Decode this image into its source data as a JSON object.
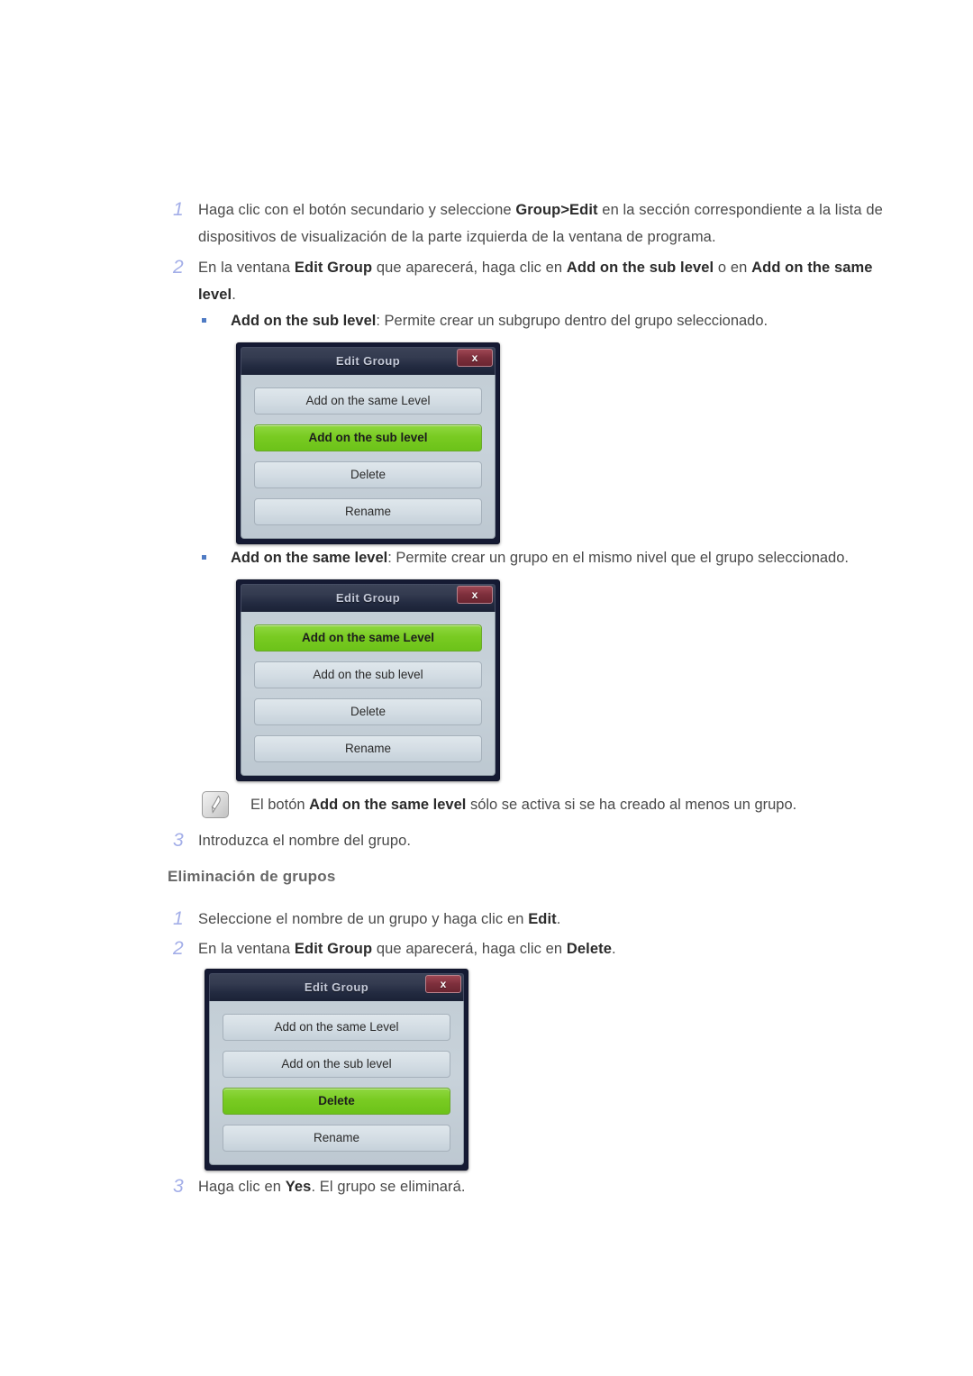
{
  "steps_create": [
    {
      "num": "1",
      "segments": [
        {
          "t": "Haga clic con el botón secundario y seleccione ",
          "b": false
        },
        {
          "t": "Group>Edit",
          "b": true
        },
        {
          "t": " en la sección correspondiente a la lista de dispositivos de visualización de la parte izquierda de la ventana de programa.",
          "b": false
        }
      ]
    },
    {
      "num": "2",
      "segments": [
        {
          "t": "En la ventana ",
          "b": false
        },
        {
          "t": "Edit Group",
          "b": true
        },
        {
          "t": " que aparecerá, haga clic en ",
          "b": false
        },
        {
          "t": "Add on the sub level",
          "b": true
        },
        {
          "t": " o en ",
          "b": false
        },
        {
          "t": "Add on the same level",
          "b": true
        },
        {
          "t": ".",
          "b": false
        }
      ]
    },
    {
      "num": "3",
      "segments": [
        {
          "t": "Introduzca el nombre del grupo.",
          "b": false
        }
      ]
    }
  ],
  "bullet_sub": {
    "marker": "square-bullet",
    "segments": [
      {
        "t": "Add on the sub level",
        "b": true
      },
      {
        "t": ": Permite crear un subgrupo dentro del grupo seleccionado.",
        "b": false
      }
    ]
  },
  "bullet_same": {
    "marker": "square-bullet",
    "segments": [
      {
        "t": "Add on the same level",
        "b": true
      },
      {
        "t": ": Permite crear un grupo en el mismo nivel que el grupo seleccionado.",
        "b": false
      }
    ]
  },
  "note": {
    "icon": "note-pencil-icon",
    "segments": [
      {
        "t": "El botón ",
        "b": false
      },
      {
        "t": "Add on the same level",
        "b": true
      },
      {
        "t": " sólo se activa si se ha creado al menos un grupo.",
        "b": false
      }
    ]
  },
  "section_heading": "Eliminación de grupos",
  "steps_delete": [
    {
      "num": "1",
      "segments": [
        {
          "t": "Seleccione el nombre de un grupo y haga clic en ",
          "b": false
        },
        {
          "t": "Edit",
          "b": true
        },
        {
          "t": ".",
          "b": false
        }
      ]
    },
    {
      "num": "2",
      "segments": [
        {
          "t": "En la ventana ",
          "b": false
        },
        {
          "t": "Edit Group",
          "b": true
        },
        {
          "t": " que aparecerá, haga clic en ",
          "b": false
        },
        {
          "t": "Delete",
          "b": true
        },
        {
          "t": ".",
          "b": false
        }
      ]
    },
    {
      "num": "3",
      "segments": [
        {
          "t": "Haga clic en ",
          "b": false
        },
        {
          "t": "Yes",
          "b": true
        },
        {
          "t": ". El grupo se eliminará.",
          "b": false
        }
      ]
    }
  ],
  "dialogs": [
    {
      "id": "dialog-sub-level",
      "title": "Edit Group",
      "close_label": "x",
      "buttons": [
        {
          "label": "Add on the same Level",
          "active": false
        },
        {
          "label": "Add on the sub level",
          "active": true
        },
        {
          "label": "Delete",
          "active": false
        },
        {
          "label": "Rename",
          "active": false
        }
      ]
    },
    {
      "id": "dialog-same-level",
      "title": "Edit Group",
      "close_label": "x",
      "buttons": [
        {
          "label": "Add on the same Level",
          "active": true
        },
        {
          "label": "Add on the sub level",
          "active": false
        },
        {
          "label": "Delete",
          "active": false
        },
        {
          "label": "Rename",
          "active": false
        }
      ]
    },
    {
      "id": "dialog-delete",
      "title": "Edit Group",
      "close_label": "x",
      "buttons": [
        {
          "label": "Add on the same Level",
          "active": false
        },
        {
          "label": "Add on the sub level",
          "active": false
        },
        {
          "label": "Delete",
          "active": true
        },
        {
          "label": "Rename",
          "active": false
        }
      ]
    }
  ],
  "colors": {
    "step_number": "#a3aee8",
    "body_text": "#4a4a4a",
    "bold_text": "#2b2b2b",
    "heading": "#676767",
    "bullet": "#4f7bc4",
    "dialog_accent_green": "#79cb22",
    "dialog_close_red": "#7e2f3c",
    "dialog_titlebar": "#343b50",
    "dialog_body": "#c8d2da"
  }
}
